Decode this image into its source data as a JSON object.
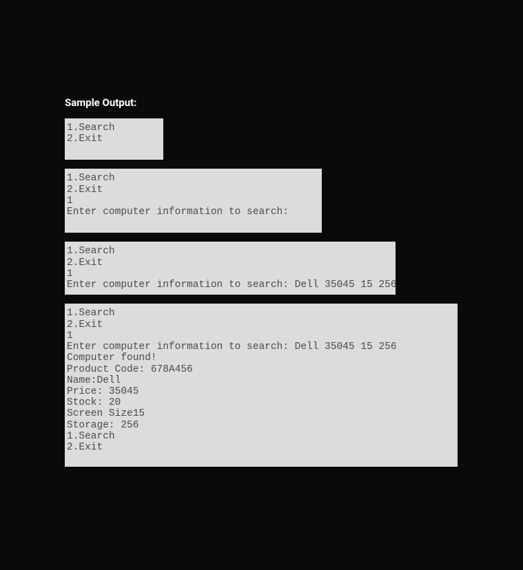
{
  "heading": "Sample Output:",
  "blocks": {
    "b1": {
      "l1": "1.Search",
      "l2": "2.Exit"
    },
    "b2": {
      "l1": "1.Search",
      "l2": "2.Exit",
      "l3": "1",
      "l4": "Enter computer information to search:"
    },
    "b3": {
      "l1": "1.Search",
      "l2": "2.Exit",
      "l3": "1",
      "l4": "Enter computer information to search: Dell 35045 15 256"
    },
    "b4": {
      "l1": "1.Search",
      "l2": "2.Exit",
      "l3": "1",
      "l4": "Enter computer information to search: Dell 35045 15 256",
      "l5": "Computer found!",
      "l6": "Product Code: 678A456",
      "l7": "Name:Dell",
      "l8": "Price: 35045",
      "l9": "Stock: 20",
      "l10": "Screen Size15",
      "l11": "Storage: 256",
      "l12": "1.Search",
      "l13": "2.Exit"
    }
  }
}
